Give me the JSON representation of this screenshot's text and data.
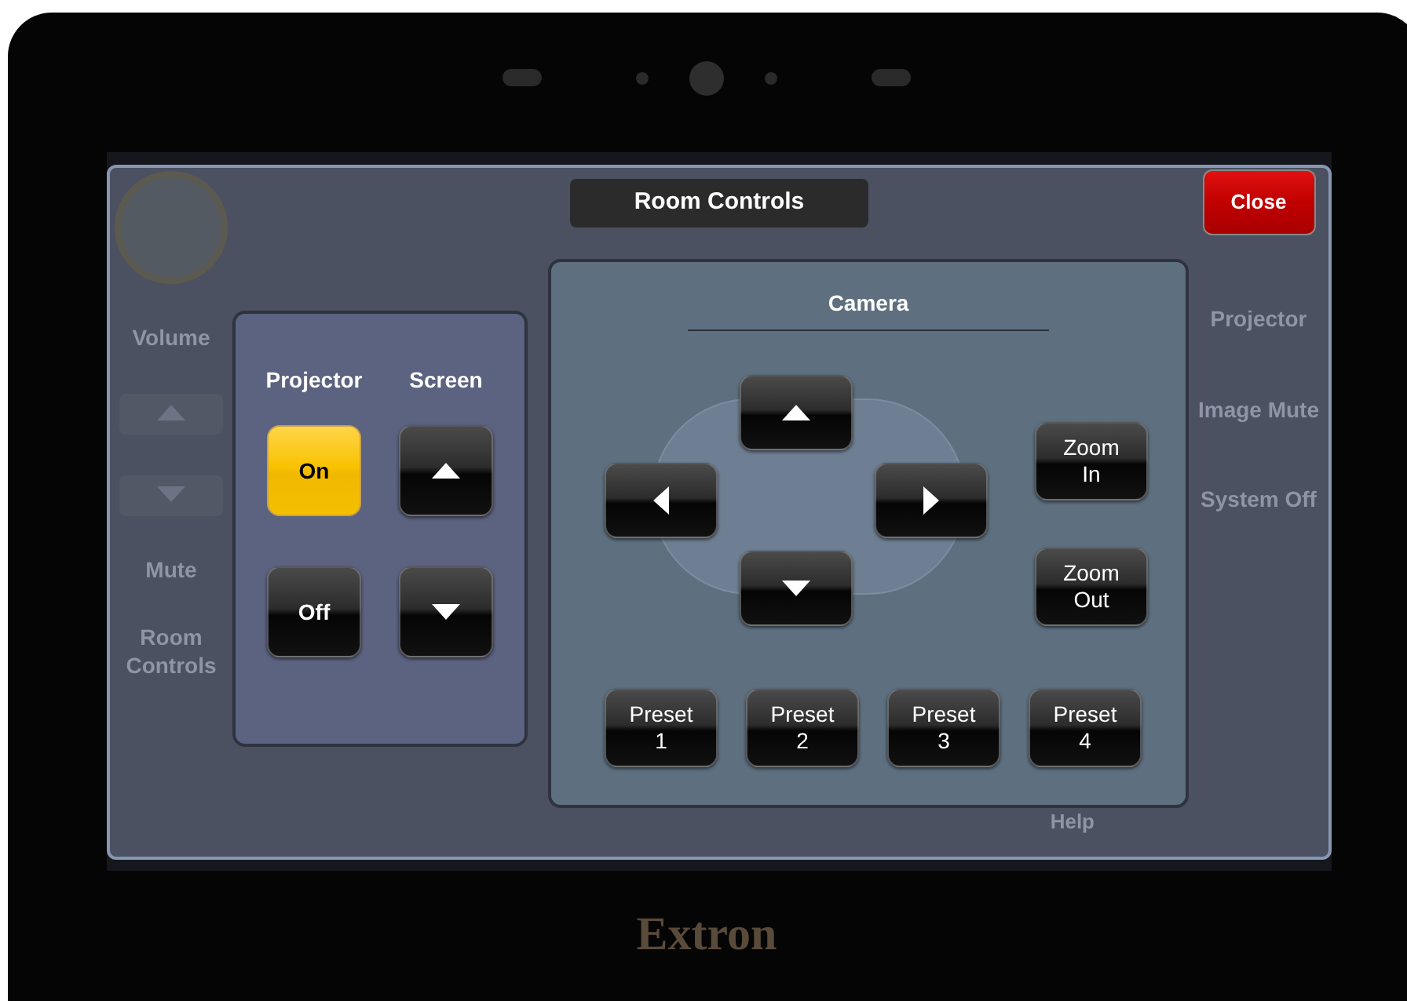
{
  "brand": "Extron",
  "background": {
    "left": [
      {
        "kind": "logo"
      },
      {
        "kind": "text",
        "label": "Volume"
      },
      {
        "kind": "up"
      },
      {
        "kind": "down"
      },
      {
        "kind": "text",
        "label": "Mute"
      },
      {
        "kind": "text",
        "label": "Room Controls"
      }
    ],
    "right": [
      {
        "kind": "text",
        "label": "Projector"
      },
      {
        "kind": "text",
        "label": "Image Mute"
      },
      {
        "kind": "text",
        "label": "System Off"
      }
    ],
    "help": "Help"
  },
  "popup": {
    "title": "Room Controls",
    "close": "Close"
  },
  "projector": {
    "heading": "Projector",
    "buttons": [
      {
        "label": "On",
        "selected": true
      },
      {
        "label": "Off",
        "selected": false
      }
    ]
  },
  "screen": {
    "heading": "Screen",
    "buttons": [
      {
        "kind": "up"
      },
      {
        "kind": "down"
      }
    ]
  },
  "camera": {
    "title": "Camera",
    "pad": [
      {
        "kind": "up"
      },
      {
        "kind": "left"
      },
      {
        "kind": "right"
      },
      {
        "kind": "down"
      }
    ],
    "zoom": [
      {
        "lines": [
          "Zoom",
          "In"
        ]
      },
      {
        "lines": [
          "Zoom",
          "Out"
        ]
      }
    ],
    "presets": [
      {
        "lines": [
          "Preset",
          "1"
        ]
      },
      {
        "lines": [
          "Preset",
          "2"
        ]
      },
      {
        "lines": [
          "Preset",
          "3"
        ]
      },
      {
        "lines": [
          "Preset",
          "4"
        ]
      }
    ]
  }
}
